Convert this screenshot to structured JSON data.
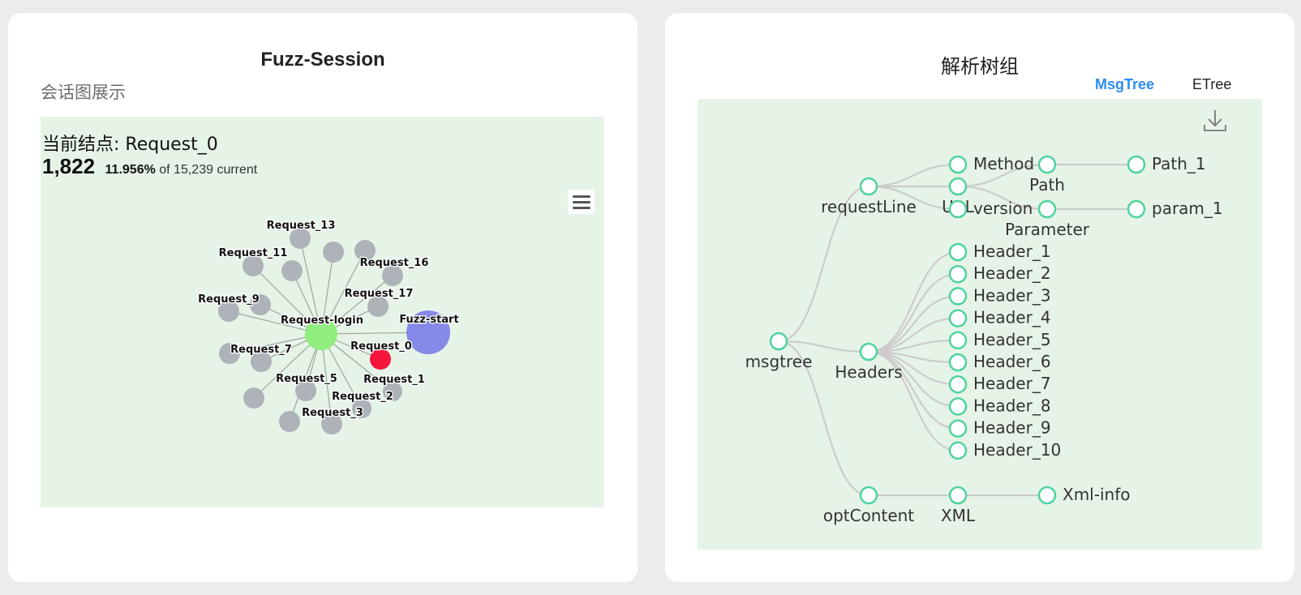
{
  "left_card": {
    "title": "Fuzz-Session",
    "subtitle": "会话图展示",
    "current_node": "当前结点: Request_0",
    "stats": {
      "count": "1,822",
      "percent": "11.956%",
      "rest": " of 15,239 current"
    },
    "graph": {
      "center": "Request-login",
      "nodes": [
        {
          "id": "Fuzz-start",
          "label": "Fuzz-start",
          "color": "#8689e8",
          "kind": "big"
        },
        {
          "id": "Request_0",
          "label": "Request_0",
          "color": "#f5163c",
          "kind": "selected"
        },
        {
          "id": "Request_1",
          "label": "Request_1",
          "color": "#adb3b8"
        },
        {
          "id": "Request_2",
          "label": "Request_2",
          "color": "#adb3b8"
        },
        {
          "id": "Request_3",
          "label": "Request_3",
          "color": "#adb3b8"
        },
        {
          "id": "Request_4",
          "label": "",
          "color": "#adb3b8"
        },
        {
          "id": "Request_5",
          "label": "Request_5",
          "color": "#adb3b8"
        },
        {
          "id": "Request_6",
          "label": "",
          "color": "#adb3b8"
        },
        {
          "id": "Request_7",
          "label": "Request_7",
          "color": "#adb3b8"
        },
        {
          "id": "Request_8",
          "label": "",
          "color": "#adb3b8"
        },
        {
          "id": "Request_9",
          "label": "Request_9",
          "color": "#adb3b8"
        },
        {
          "id": "Request_10",
          "label": "",
          "color": "#adb3b8"
        },
        {
          "id": "Request_11",
          "label": "Request_11",
          "color": "#adb3b8"
        },
        {
          "id": "Request_12",
          "label": "",
          "color": "#adb3b8"
        },
        {
          "id": "Request_13",
          "label": "Request_13",
          "color": "#adb3b8"
        },
        {
          "id": "Request_14",
          "label": "",
          "color": "#adb3b8"
        },
        {
          "id": "Request_15",
          "label": "",
          "color": "#adb3b8"
        },
        {
          "id": "Request_16",
          "label": "Request_16",
          "color": "#adb3b8"
        },
        {
          "id": "Request_17",
          "label": "Request_17",
          "color": "#adb3b8"
        },
        {
          "id": "Request_18",
          "label": "",
          "color": "#adb3b8"
        }
      ],
      "center_color": "#90ee7e",
      "edge_color": "#9aa69a"
    }
  },
  "right_card": {
    "title": "解析树组",
    "tabs": [
      {
        "label": "MsgTree",
        "active": true
      },
      {
        "label": "ETree",
        "active": false
      }
    ],
    "download_icon": "download-icon",
    "tree": {
      "node_stroke": "#4fd3a0",
      "link_color": "#cccccc",
      "root": "msgtree",
      "children": [
        {
          "name": "requestLine",
          "children": [
            {
              "name": "Method"
            },
            {
              "name": "URL",
              "children": [
                {
                  "name": "Path",
                  "children": [
                    {
                      "name": "Path_1"
                    }
                  ]
                },
                {
                  "name": "Parameter",
                  "children": [
                    {
                      "name": "param_1"
                    }
                  ]
                }
              ]
            },
            {
              "name": "version"
            }
          ]
        },
        {
          "name": "Headers",
          "children": [
            {
              "name": "Header_1"
            },
            {
              "name": "Header_2"
            },
            {
              "name": "Header_3"
            },
            {
              "name": "Header_4"
            },
            {
              "name": "Header_5"
            },
            {
              "name": "Header_6"
            },
            {
              "name": "Header_7"
            },
            {
              "name": "Header_8"
            },
            {
              "name": "Header_9"
            },
            {
              "name": "Header_10"
            }
          ]
        },
        {
          "name": "optContent",
          "children": [
            {
              "name": "XML",
              "children": [
                {
                  "name": "Xml-info"
                }
              ]
            }
          ]
        }
      ]
    }
  }
}
